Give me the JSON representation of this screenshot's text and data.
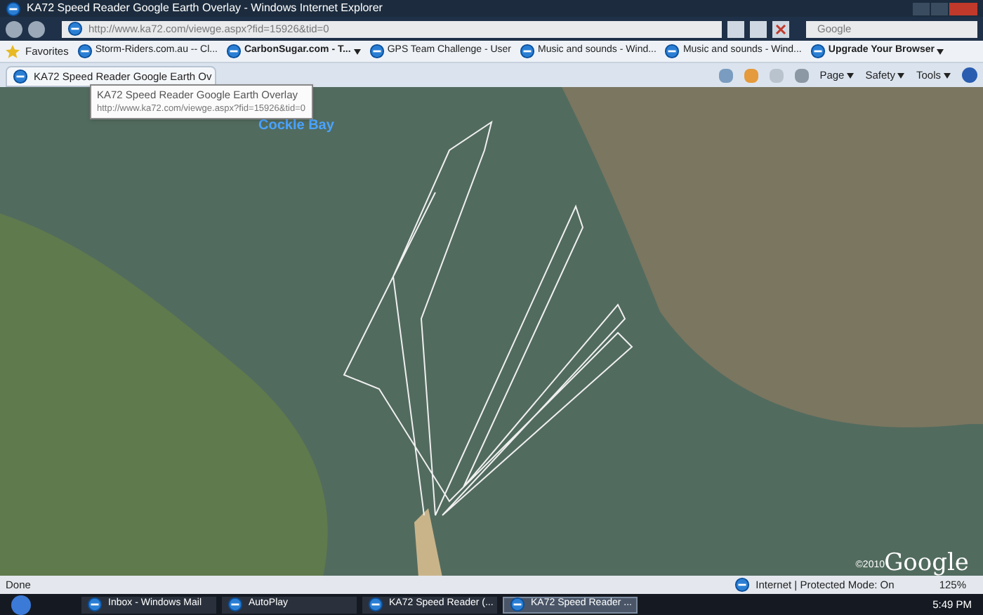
{
  "window": {
    "title": "KA72 Speed Reader Google Earth Overlay - Windows Internet Explorer"
  },
  "address_bar": {
    "url": "http://www.ka72.com/viewge.aspx?fid=15926&tid=0"
  },
  "search": {
    "placeholder": "Google"
  },
  "favorites_bar": {
    "label": "Favorites",
    "items": [
      {
        "label": "Storm-Riders.com.au -- Cl...",
        "bold": false,
        "dropdown": false
      },
      {
        "label": "CarbonSugar.com - T...",
        "bold": true,
        "dropdown": true
      },
      {
        "label": "GPS Team Challenge - User",
        "bold": false,
        "dropdown": false
      },
      {
        "label": "Music and sounds - Wind...",
        "bold": false,
        "dropdown": false
      },
      {
        "label": "Music and sounds - Wind...",
        "bold": false,
        "dropdown": false
      },
      {
        "label": "Upgrade Your Browser",
        "bold": true,
        "dropdown": true
      }
    ]
  },
  "tab": {
    "label": "KA72 Speed Reader Google Earth Ov"
  },
  "command_bar": {
    "menus": [
      "Page",
      "Safety",
      "Tools"
    ]
  },
  "tooltip": {
    "title": "KA72 Speed Reader Google Earth Overlay",
    "url": "http://www.ka72.com/viewge.aspx?fid=15926&tid=0"
  },
  "map": {
    "place_label": "Cockle Bay",
    "logo": "Google",
    "copyright": "©2010"
  },
  "status_bar": {
    "text": "Done",
    "zone": "Internet | Protected Mode: On",
    "zoom": "125%"
  },
  "taskbar": {
    "items": [
      {
        "label": "Inbox - Windows Mail",
        "selected": false
      },
      {
        "label": "AutoPlay",
        "selected": false
      },
      {
        "label": "KA72 Speed Reader (...",
        "selected": false
      },
      {
        "label": "KA72 Speed Reader ...",
        "selected": true
      }
    ],
    "clock": "5:49 PM"
  }
}
